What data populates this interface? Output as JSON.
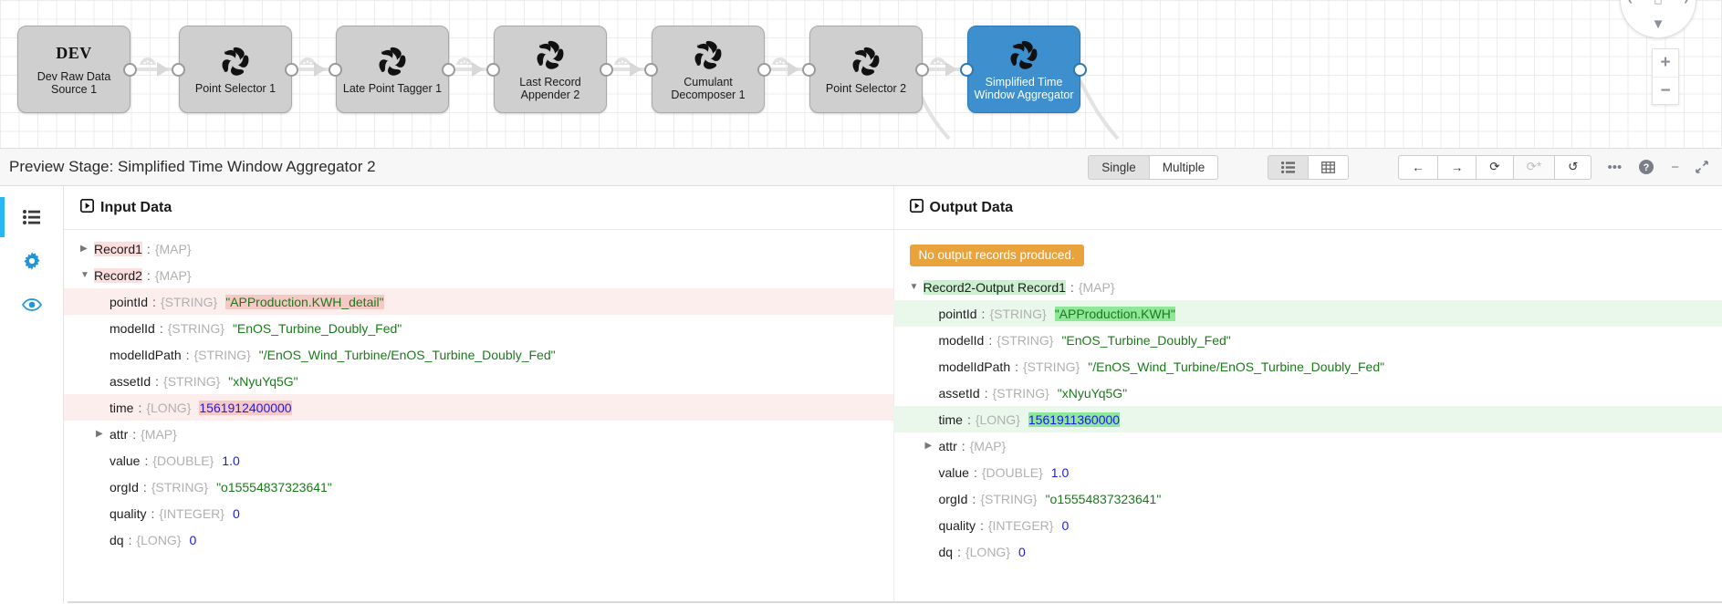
{
  "pipeline": {
    "nodes": [
      {
        "id": "n1",
        "label": "Dev Raw Data Source 1",
        "badge": "DEV",
        "icon": "pipeline-stage-icon",
        "selected": false
      },
      {
        "id": "n2",
        "label": "Point Selector 1",
        "badge": "",
        "icon": "pipeline-stage-icon",
        "selected": false
      },
      {
        "id": "n3",
        "label": "Late Point Tagger 1",
        "badge": "",
        "icon": "pipeline-stage-icon",
        "selected": false
      },
      {
        "id": "n4",
        "label": "Last Record Appender 2",
        "badge": "",
        "icon": "pipeline-stage-icon",
        "selected": false
      },
      {
        "id": "n5",
        "label": "Cumulant Decomposer 1",
        "badge": "",
        "icon": "pipeline-stage-icon",
        "selected": false
      },
      {
        "id": "n6",
        "label": "Point Selector 2",
        "badge": "",
        "icon": "pipeline-stage-icon",
        "selected": false
      },
      {
        "id": "n7",
        "label": "Simplified Time Window Aggregator",
        "badge": "",
        "icon": "pipeline-stage-icon",
        "selected": true
      }
    ],
    "nav": {
      "up": "▲",
      "down": "▼",
      "left": "‹",
      "right": "›",
      "home": "⌂",
      "zoom_in": "+",
      "zoom_out": "−"
    },
    "selected_color": "#3d8fce"
  },
  "header": {
    "title": "Preview Stage: Simplified Time Window Aggregator 2",
    "record_mode": {
      "options": [
        "Single",
        "Multiple"
      ],
      "selected": "Single"
    },
    "view_mode": {
      "options": [
        "list-view",
        "table-view"
      ],
      "selected": "list-view"
    },
    "nav_buttons": [
      {
        "name": "step-back-button",
        "glyph": "←",
        "disabled": false
      },
      {
        "name": "step-forward-button",
        "glyph": "→",
        "disabled": false
      },
      {
        "name": "run-preview-button",
        "glyph": "⟳",
        "disabled": false
      },
      {
        "name": "run-with-config-button",
        "glyph": "⟳*",
        "disabled": true
      },
      {
        "name": "revert-button",
        "glyph": "↺",
        "disabled": false
      }
    ],
    "utility_buttons": [
      {
        "name": "more-options-button",
        "glyph": "•••"
      },
      {
        "name": "help-button",
        "glyph": "?"
      },
      {
        "name": "minimize-button",
        "glyph": "−"
      },
      {
        "name": "expand-button",
        "glyph": "⤢"
      }
    ]
  },
  "sidebar": {
    "items": [
      {
        "name": "sidebar-item-records",
        "icon": "list-icon",
        "active": true
      },
      {
        "name": "sidebar-item-properties",
        "icon": "gear-icon",
        "active": false
      },
      {
        "name": "sidebar-item-preview",
        "icon": "eye-icon",
        "active": false
      }
    ]
  },
  "input_panel": {
    "title": "Input Data",
    "icon": "play-box-icon",
    "records": [
      {
        "label": "Record1",
        "type": "{MAP}",
        "expanded": false,
        "label_mark": true,
        "fields": []
      },
      {
        "label": "Record2",
        "type": "{MAP}",
        "expanded": true,
        "label_mark": true,
        "fields": [
          {
            "key": "pointId",
            "type": "{STRING}",
            "value": "\"APProduction.KWH_detail\"",
            "vclass": "str",
            "highlight": true,
            "mark": true
          },
          {
            "key": "modelId",
            "type": "{STRING}",
            "value": "\"EnOS_Turbine_Doubly_Fed\"",
            "vclass": "str",
            "highlight": false,
            "mark": false
          },
          {
            "key": "modelIdPath",
            "type": "{STRING}",
            "value": "\"/EnOS_Wind_Turbine/EnOS_Turbine_Doubly_Fed\"",
            "vclass": "str",
            "highlight": false,
            "mark": false
          },
          {
            "key": "assetId",
            "type": "{STRING}",
            "value": "\"xNyuYq5G\"",
            "vclass": "str",
            "highlight": false,
            "mark": false
          },
          {
            "key": "time",
            "type": "{LONG}",
            "value": "1561912400000",
            "vclass": "num",
            "highlight": true,
            "mark": true
          },
          {
            "key": "attr",
            "type": "{MAP}",
            "value": "",
            "vclass": "",
            "highlight": false,
            "mark": false,
            "expander": "collapsed"
          },
          {
            "key": "value",
            "type": "{DOUBLE}",
            "value": "1.0",
            "vclass": "num",
            "highlight": false,
            "mark": false
          },
          {
            "key": "orgId",
            "type": "{STRING}",
            "value": "\"o15554837323641\"",
            "vclass": "str",
            "highlight": false,
            "mark": false
          },
          {
            "key": "quality",
            "type": "{INTEGER}",
            "value": "0",
            "vclass": "num",
            "highlight": false,
            "mark": false
          },
          {
            "key": "dq",
            "type": "{LONG}",
            "value": "0",
            "vclass": "num",
            "highlight": false,
            "mark": false
          }
        ]
      }
    ]
  },
  "output_panel": {
    "title": "Output Data",
    "icon": "play-box-icon",
    "notice": "No output records produced.",
    "notice_color": "#e8a33d",
    "records": [
      {
        "label": "Record2-Output Record1",
        "type": "{MAP}",
        "expanded": true,
        "label_mark": true,
        "fields": [
          {
            "key": "pointId",
            "type": "{STRING}",
            "value": "\"APProduction.KWH\"",
            "vclass": "str",
            "highlight": true,
            "mark": true
          },
          {
            "key": "modelId",
            "type": "{STRING}",
            "value": "\"EnOS_Turbine_Doubly_Fed\"",
            "vclass": "str",
            "highlight": false,
            "mark": false
          },
          {
            "key": "modelIdPath",
            "type": "{STRING}",
            "value": "\"/EnOS_Wind_Turbine/EnOS_Turbine_Doubly_Fed\"",
            "vclass": "str",
            "highlight": false,
            "mark": false
          },
          {
            "key": "assetId",
            "type": "{STRING}",
            "value": "\"xNyuYq5G\"",
            "vclass": "str",
            "highlight": false,
            "mark": false
          },
          {
            "key": "time",
            "type": "{LONG}",
            "value": "1561911360000",
            "vclass": "num",
            "highlight": true,
            "mark": true
          },
          {
            "key": "attr",
            "type": "{MAP}",
            "value": "",
            "vclass": "",
            "highlight": false,
            "mark": false,
            "expander": "collapsed"
          },
          {
            "key": "value",
            "type": "{DOUBLE}",
            "value": "1.0",
            "vclass": "num",
            "highlight": false,
            "mark": false
          },
          {
            "key": "orgId",
            "type": "{STRING}",
            "value": "\"o15554837323641\"",
            "vclass": "str",
            "highlight": false,
            "mark": false
          },
          {
            "key": "quality",
            "type": "{INTEGER}",
            "value": "0",
            "vclass": "num",
            "highlight": false,
            "mark": false
          },
          {
            "key": "dq",
            "type": "{LONG}",
            "value": "0",
            "vclass": "num",
            "highlight": false,
            "mark": false
          }
        ]
      }
    ]
  }
}
